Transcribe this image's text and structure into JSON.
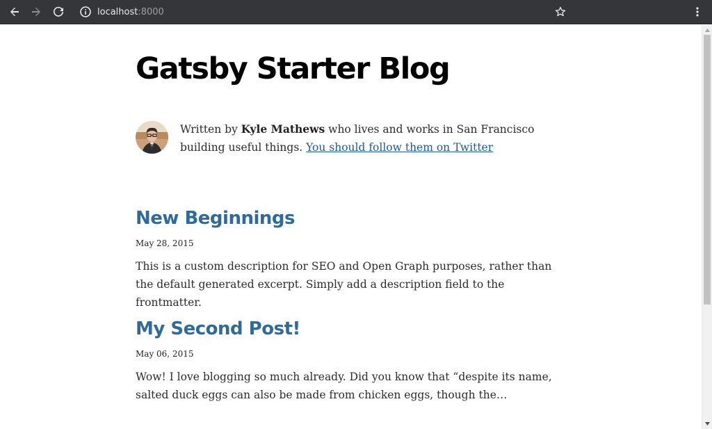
{
  "browser": {
    "url_host": "localhost",
    "url_port": ":8000",
    "icons": {
      "back": "arrow-left-icon",
      "forward": "arrow-right-icon",
      "reload": "reload-icon",
      "site_info": "info-icon",
      "bookmark": "star-icon",
      "menu": "kebab-menu-icon"
    },
    "colors": {
      "toolbar_bg": "#35363a",
      "url_text": "#e8eaed"
    }
  },
  "page": {
    "site_title": "Gatsby Starter Blog",
    "bio": {
      "prefix": "Written by ",
      "author": "Kyle Mathews",
      "suffix": " who lives and works in San Francisco building useful things. ",
      "link_text": "You should follow them on Twitter"
    },
    "posts": [
      {
        "title": "New Beginnings",
        "date": "May 28, 2015",
        "excerpt": "This is a custom description for SEO and Open Graph purposes, rather than the default generated excerpt. Simply add a description field to the frontmatter."
      },
      {
        "title": "My Second Post!",
        "date": "May 06, 2015",
        "excerpt": "Wow! I love blogging so much already. Did you know that “despite its name, salted duck eggs can also be made from chicken eggs, though the…"
      }
    ],
    "colors": {
      "link": "#1c5b91",
      "post_title": "#2f6a9a"
    }
  }
}
